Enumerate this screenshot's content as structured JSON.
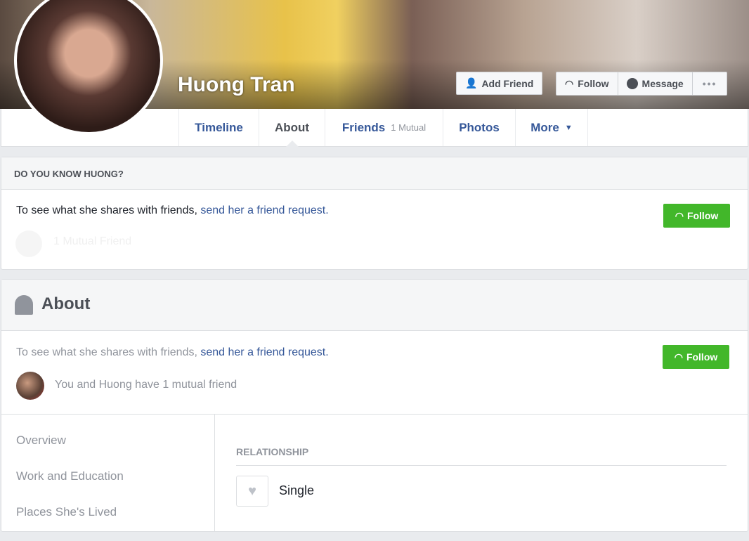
{
  "profile": {
    "name": "Huong Tran"
  },
  "actions": {
    "add_friend": "Add Friend",
    "follow": "Follow",
    "message": "Message",
    "more": "•••"
  },
  "tabs": [
    {
      "label": "Timeline"
    },
    {
      "label": "About"
    },
    {
      "label": "Friends",
      "badge": "1 Mutual"
    },
    {
      "label": "Photos"
    },
    {
      "label": "More"
    }
  ],
  "know": {
    "title": "DO YOU KNOW HUONG?",
    "text": "To see what she shares with friends,",
    "link": "send her a friend request.",
    "mutual": "1 Mutual Friend",
    "follow": "Follow"
  },
  "about": {
    "title": "About",
    "text": "To see what she shares with friends,",
    "link": "send her a friend request.",
    "mutual": "You and Huong have 1 mutual friend",
    "follow": "Follow",
    "sidebar": [
      "Overview",
      "Work and Education",
      "Places She's Lived"
    ],
    "section_title": "RELATIONSHIP",
    "relationship": "Single"
  },
  "colors": {
    "link": "#365899",
    "green": "#42b72a"
  }
}
